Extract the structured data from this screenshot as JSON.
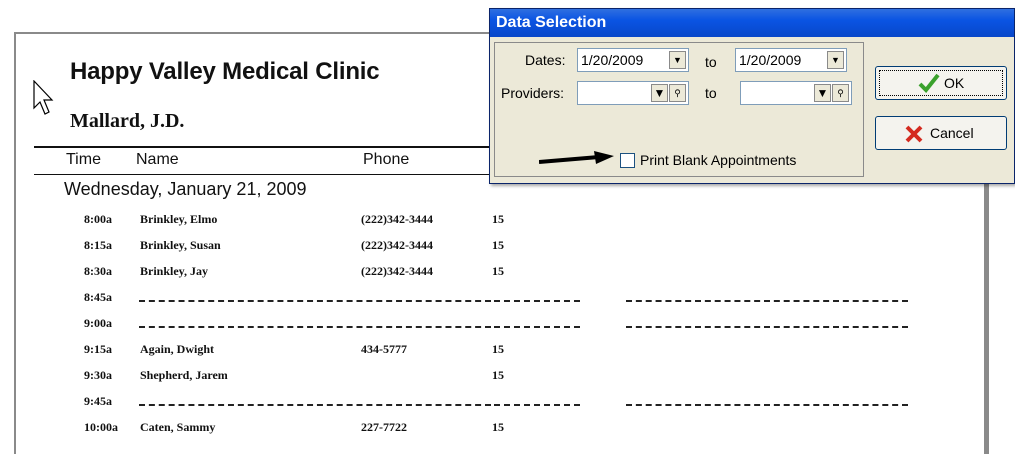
{
  "report": {
    "title": "Happy Valley Medical Clinic",
    "provider": "Mallard, J.D.",
    "columns": {
      "time": "Time",
      "name": "Name",
      "phone": "Phone"
    },
    "day_heading": "Wednesday, January 21, 2009",
    "appointments": [
      {
        "time": "8:00a",
        "name": "Brinkley, Elmo",
        "phone": "(222)342-3444",
        "length": "15",
        "blank": false
      },
      {
        "time": "8:15a",
        "name": "Brinkley, Susan",
        "phone": "(222)342-3444",
        "length": "15",
        "blank": false
      },
      {
        "time": "8:30a",
        "name": "Brinkley, Jay",
        "phone": "(222)342-3444",
        "length": "15",
        "blank": false
      },
      {
        "time": "8:45a",
        "name": "",
        "phone": "",
        "length": "",
        "blank": true
      },
      {
        "time": "9:00a",
        "name": "",
        "phone": "",
        "length": "",
        "blank": true
      },
      {
        "time": "9:15a",
        "name": "Again, Dwight",
        "phone": "434-5777",
        "length": "15",
        "blank": false
      },
      {
        "time": "9:30a",
        "name": "Shepherd, Jarem",
        "phone": "",
        "length": "15",
        "blank": false
      },
      {
        "time": "9:45a",
        "name": "",
        "phone": "",
        "length": "",
        "blank": true
      },
      {
        "time": "10:00a",
        "name": "Caten, Sammy",
        "phone": "227-7722",
        "length": "15",
        "blank": false
      }
    ]
  },
  "dialog": {
    "title": "Data Selection",
    "dates_label": "Dates:",
    "date_from": "1/20/2009",
    "to_label": "to",
    "date_to": "1/20/2009",
    "providers_label": "Providers:",
    "provider_from": "",
    "provider_to": "",
    "print_blank_label": "Print Blank Appointments",
    "print_blank_checked": false,
    "ok_label": "OK",
    "cancel_label": "Cancel"
  },
  "colors": {
    "titlebar": "#0a54e3",
    "dialog_bg": "#ece9d8",
    "ok_check": "#3aa12c",
    "cancel_x": "#d42a1f"
  },
  "icons": [
    "mouse-pointer-icon",
    "arrow-icon",
    "dropdown-icon",
    "search-icon",
    "checkmark-icon",
    "x-icon"
  ]
}
